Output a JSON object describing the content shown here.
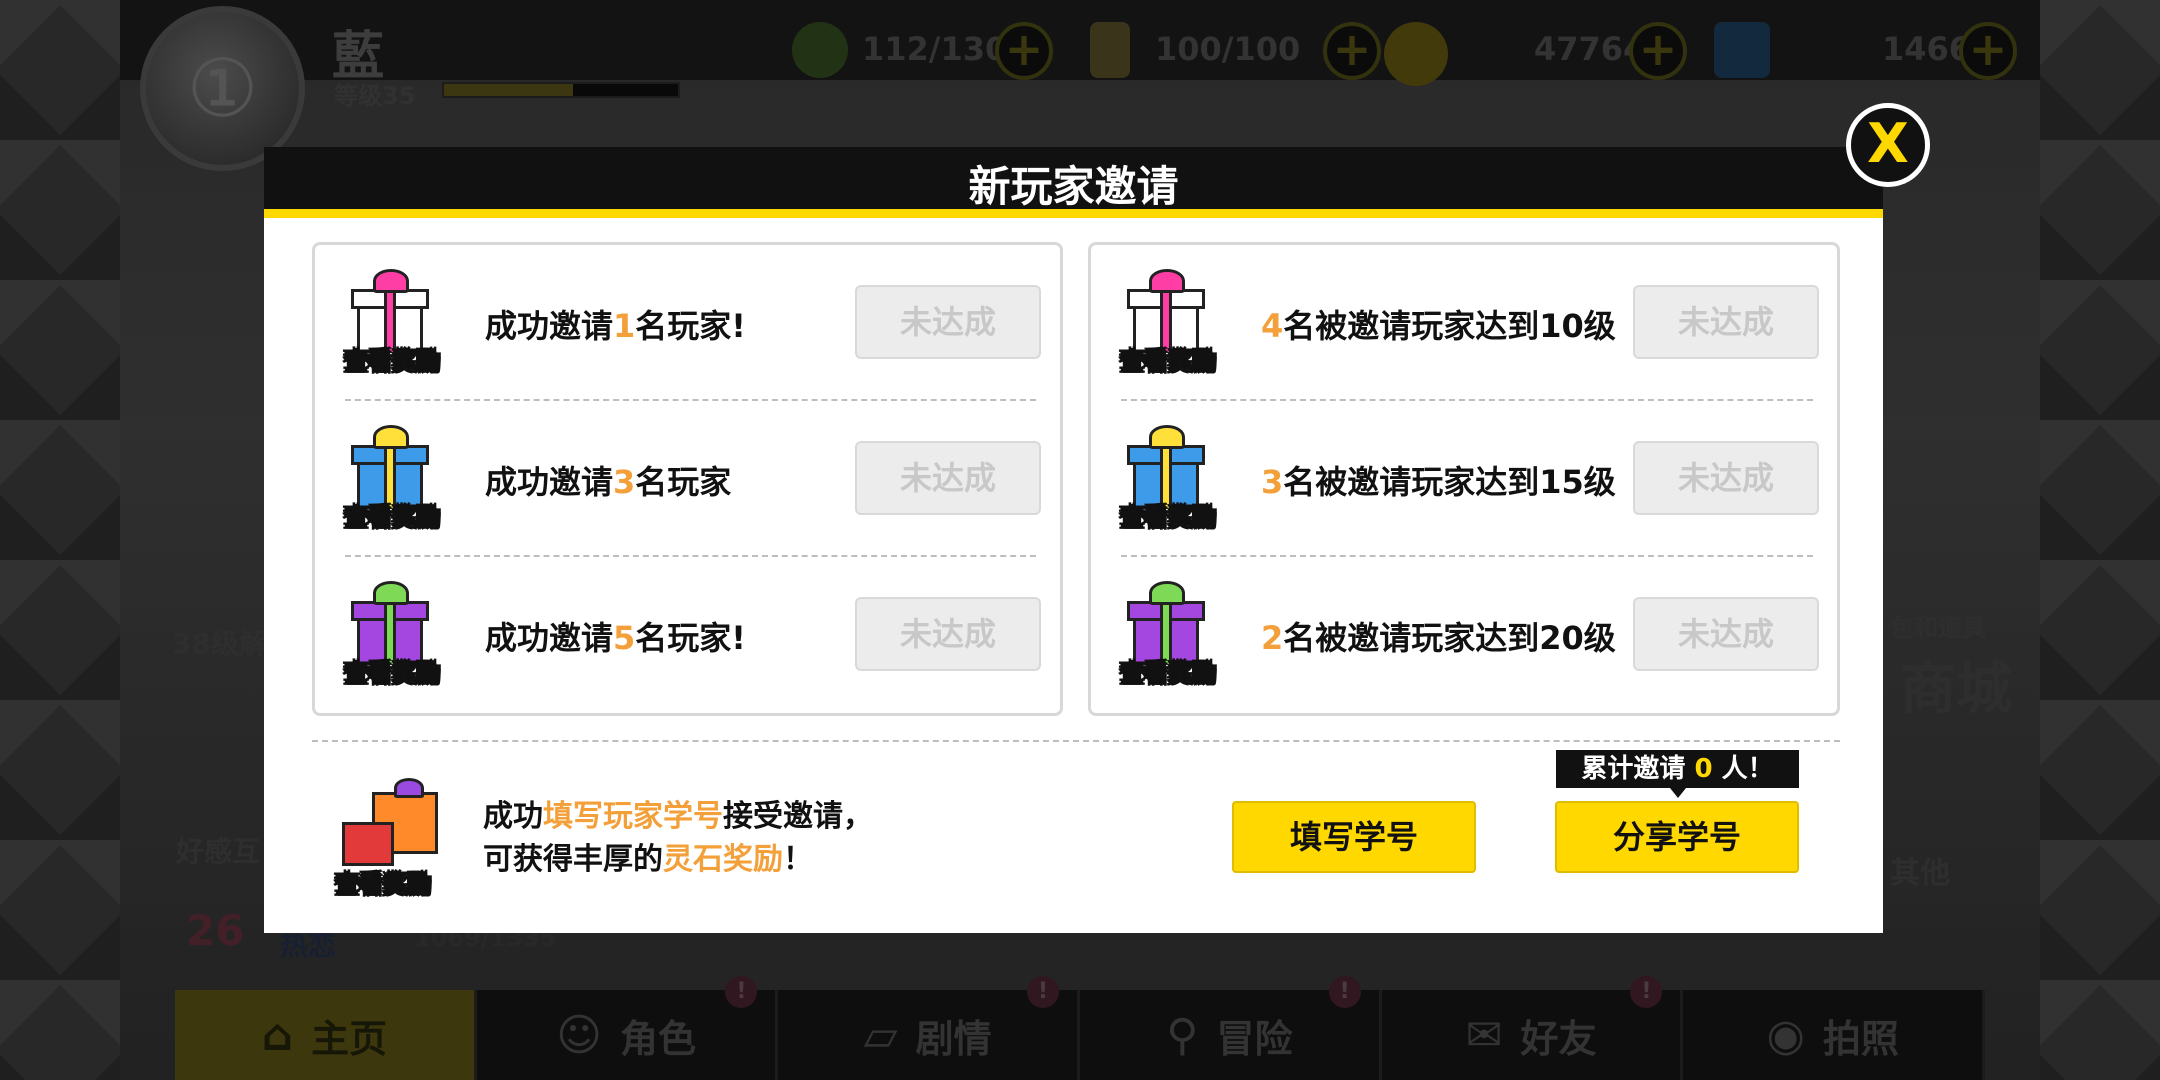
{
  "player": {
    "name": "藍",
    "level_label": "等级",
    "level": "35",
    "exp_fraction": 0.55
  },
  "resources": [
    {
      "name": "stamina",
      "value": "112/130",
      "icon": "leaf-icon",
      "color": "#4a7a2a"
    },
    {
      "name": "energy",
      "value": "100/100",
      "icon": "drink-icon",
      "color": "#8a7a3a"
    },
    {
      "name": "gold",
      "value": "47764",
      "icon": "coin-icon",
      "color": "#8a7a1a"
    },
    {
      "name": "gem",
      "value": "1466",
      "icon": "cube-icon",
      "color": "#2a5a8a"
    }
  ],
  "background": {
    "side_left_1": "38级解",
    "side_left_2": "好感互",
    "affection_level": "26",
    "affection_label": "热恋",
    "affection_progress": "1069/1335",
    "side_right_1": "包和道具",
    "side_right_2": "商城",
    "side_right_3": "其他"
  },
  "nav": [
    {
      "label": "主页",
      "icon": "⌂",
      "active": true,
      "badge": false
    },
    {
      "label": "角色",
      "icon": "☺",
      "active": false,
      "badge": true
    },
    {
      "label": "剧情",
      "icon": "▱",
      "active": false,
      "badge": true
    },
    {
      "label": "冒险",
      "icon": "⚲",
      "active": false,
      "badge": true
    },
    {
      "label": "好友",
      "icon": "✉",
      "active": false,
      "badge": true
    },
    {
      "label": "拍照",
      "icon": "◉",
      "active": false,
      "badge": false
    }
  ],
  "badge_symbol": "!",
  "modal": {
    "title": "新玩家邀请",
    "close": "X",
    "reward_label": "查看奖励",
    "left_rows": [
      {
        "prefix": "成功邀请",
        "num": "1",
        "suffix": "名玩家!",
        "status": "未达成",
        "gift_color": "#ffffff",
        "bow_color": "#ff3ea5"
      },
      {
        "prefix": "成功邀请",
        "num": "3",
        "suffix": "名玩家",
        "status": "未达成",
        "gift_color": "#3d9be9",
        "bow_color": "#ffe03a"
      },
      {
        "prefix": "成功邀请",
        "num": "5",
        "suffix": "名玩家!",
        "status": "未达成",
        "gift_color": "#a347e0",
        "bow_color": "#7ed957"
      }
    ],
    "right_rows": [
      {
        "prefix": "",
        "num": "4",
        "suffix": "名被邀请玩家达到10级",
        "status": "未达成",
        "gift_color": "#ffffff",
        "bow_color": "#ff3ea5"
      },
      {
        "prefix": "",
        "num": "3",
        "suffix": "名被邀请玩家达到15级",
        "status": "未达成",
        "gift_color": "#3d9be9",
        "bow_color": "#ffe03a"
      },
      {
        "prefix": "",
        "num": "2",
        "suffix": "名被邀请玩家达到20级",
        "status": "未达成",
        "gift_color": "#a347e0",
        "bow_color": "#7ed957"
      }
    ],
    "bottom": {
      "line1_a": "成功",
      "line1_hl": "填写玩家学号",
      "line1_b": "接受邀请，",
      "line2_a": "可获得丰厚的",
      "line2_hl": "灵石奖励",
      "line2_b": "！",
      "fill_button": "填写学号",
      "share_button": "分享学号",
      "tooltip_a": "累计邀请",
      "tooltip_count": "0",
      "tooltip_b": "人！"
    }
  }
}
